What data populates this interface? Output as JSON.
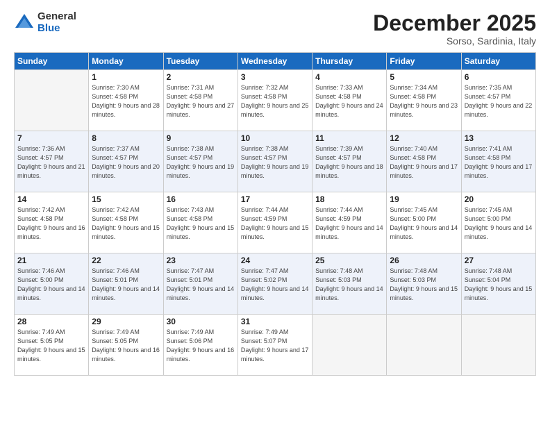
{
  "logo": {
    "general": "General",
    "blue": "Blue"
  },
  "header": {
    "month": "December 2025",
    "location": "Sorso, Sardinia, Italy"
  },
  "days_of_week": [
    "Sunday",
    "Monday",
    "Tuesday",
    "Wednesday",
    "Thursday",
    "Friday",
    "Saturday"
  ],
  "weeks": [
    [
      {
        "day": "",
        "sunrise": "",
        "sunset": "",
        "daylight": ""
      },
      {
        "day": "1",
        "sunrise": "Sunrise: 7:30 AM",
        "sunset": "Sunset: 4:58 PM",
        "daylight": "Daylight: 9 hours and 28 minutes."
      },
      {
        "day": "2",
        "sunrise": "Sunrise: 7:31 AM",
        "sunset": "Sunset: 4:58 PM",
        "daylight": "Daylight: 9 hours and 27 minutes."
      },
      {
        "day": "3",
        "sunrise": "Sunrise: 7:32 AM",
        "sunset": "Sunset: 4:58 PM",
        "daylight": "Daylight: 9 hours and 25 minutes."
      },
      {
        "day": "4",
        "sunrise": "Sunrise: 7:33 AM",
        "sunset": "Sunset: 4:58 PM",
        "daylight": "Daylight: 9 hours and 24 minutes."
      },
      {
        "day": "5",
        "sunrise": "Sunrise: 7:34 AM",
        "sunset": "Sunset: 4:58 PM",
        "daylight": "Daylight: 9 hours and 23 minutes."
      },
      {
        "day": "6",
        "sunrise": "Sunrise: 7:35 AM",
        "sunset": "Sunset: 4:57 PM",
        "daylight": "Daylight: 9 hours and 22 minutes."
      }
    ],
    [
      {
        "day": "7",
        "sunrise": "Sunrise: 7:36 AM",
        "sunset": "Sunset: 4:57 PM",
        "daylight": "Daylight: 9 hours and 21 minutes."
      },
      {
        "day": "8",
        "sunrise": "Sunrise: 7:37 AM",
        "sunset": "Sunset: 4:57 PM",
        "daylight": "Daylight: 9 hours and 20 minutes."
      },
      {
        "day": "9",
        "sunrise": "Sunrise: 7:38 AM",
        "sunset": "Sunset: 4:57 PM",
        "daylight": "Daylight: 9 hours and 19 minutes."
      },
      {
        "day": "10",
        "sunrise": "Sunrise: 7:38 AM",
        "sunset": "Sunset: 4:57 PM",
        "daylight": "Daylight: 9 hours and 19 minutes."
      },
      {
        "day": "11",
        "sunrise": "Sunrise: 7:39 AM",
        "sunset": "Sunset: 4:57 PM",
        "daylight": "Daylight: 9 hours and 18 minutes."
      },
      {
        "day": "12",
        "sunrise": "Sunrise: 7:40 AM",
        "sunset": "Sunset: 4:58 PM",
        "daylight": "Daylight: 9 hours and 17 minutes."
      },
      {
        "day": "13",
        "sunrise": "Sunrise: 7:41 AM",
        "sunset": "Sunset: 4:58 PM",
        "daylight": "Daylight: 9 hours and 17 minutes."
      }
    ],
    [
      {
        "day": "14",
        "sunrise": "Sunrise: 7:42 AM",
        "sunset": "Sunset: 4:58 PM",
        "daylight": "Daylight: 9 hours and 16 minutes."
      },
      {
        "day": "15",
        "sunrise": "Sunrise: 7:42 AM",
        "sunset": "Sunset: 4:58 PM",
        "daylight": "Daylight: 9 hours and 15 minutes."
      },
      {
        "day": "16",
        "sunrise": "Sunrise: 7:43 AM",
        "sunset": "Sunset: 4:58 PM",
        "daylight": "Daylight: 9 hours and 15 minutes."
      },
      {
        "day": "17",
        "sunrise": "Sunrise: 7:44 AM",
        "sunset": "Sunset: 4:59 PM",
        "daylight": "Daylight: 9 hours and 15 minutes."
      },
      {
        "day": "18",
        "sunrise": "Sunrise: 7:44 AM",
        "sunset": "Sunset: 4:59 PM",
        "daylight": "Daylight: 9 hours and 14 minutes."
      },
      {
        "day": "19",
        "sunrise": "Sunrise: 7:45 AM",
        "sunset": "Sunset: 5:00 PM",
        "daylight": "Daylight: 9 hours and 14 minutes."
      },
      {
        "day": "20",
        "sunrise": "Sunrise: 7:45 AM",
        "sunset": "Sunset: 5:00 PM",
        "daylight": "Daylight: 9 hours and 14 minutes."
      }
    ],
    [
      {
        "day": "21",
        "sunrise": "Sunrise: 7:46 AM",
        "sunset": "Sunset: 5:00 PM",
        "daylight": "Daylight: 9 hours and 14 minutes."
      },
      {
        "day": "22",
        "sunrise": "Sunrise: 7:46 AM",
        "sunset": "Sunset: 5:01 PM",
        "daylight": "Daylight: 9 hours and 14 minutes."
      },
      {
        "day": "23",
        "sunrise": "Sunrise: 7:47 AM",
        "sunset": "Sunset: 5:01 PM",
        "daylight": "Daylight: 9 hours and 14 minutes."
      },
      {
        "day": "24",
        "sunrise": "Sunrise: 7:47 AM",
        "sunset": "Sunset: 5:02 PM",
        "daylight": "Daylight: 9 hours and 14 minutes."
      },
      {
        "day": "25",
        "sunrise": "Sunrise: 7:48 AM",
        "sunset": "Sunset: 5:03 PM",
        "daylight": "Daylight: 9 hours and 14 minutes."
      },
      {
        "day": "26",
        "sunrise": "Sunrise: 7:48 AM",
        "sunset": "Sunset: 5:03 PM",
        "daylight": "Daylight: 9 hours and 15 minutes."
      },
      {
        "day": "27",
        "sunrise": "Sunrise: 7:48 AM",
        "sunset": "Sunset: 5:04 PM",
        "daylight": "Daylight: 9 hours and 15 minutes."
      }
    ],
    [
      {
        "day": "28",
        "sunrise": "Sunrise: 7:49 AM",
        "sunset": "Sunset: 5:05 PM",
        "daylight": "Daylight: 9 hours and 15 minutes."
      },
      {
        "day": "29",
        "sunrise": "Sunrise: 7:49 AM",
        "sunset": "Sunset: 5:05 PM",
        "daylight": "Daylight: 9 hours and 16 minutes."
      },
      {
        "day": "30",
        "sunrise": "Sunrise: 7:49 AM",
        "sunset": "Sunset: 5:06 PM",
        "daylight": "Daylight: 9 hours and 16 minutes."
      },
      {
        "day": "31",
        "sunrise": "Sunrise: 7:49 AM",
        "sunset": "Sunset: 5:07 PM",
        "daylight": "Daylight: 9 hours and 17 minutes."
      },
      {
        "day": "",
        "sunrise": "",
        "sunset": "",
        "daylight": ""
      },
      {
        "day": "",
        "sunrise": "",
        "sunset": "",
        "daylight": ""
      },
      {
        "day": "",
        "sunrise": "",
        "sunset": "",
        "daylight": ""
      }
    ]
  ]
}
